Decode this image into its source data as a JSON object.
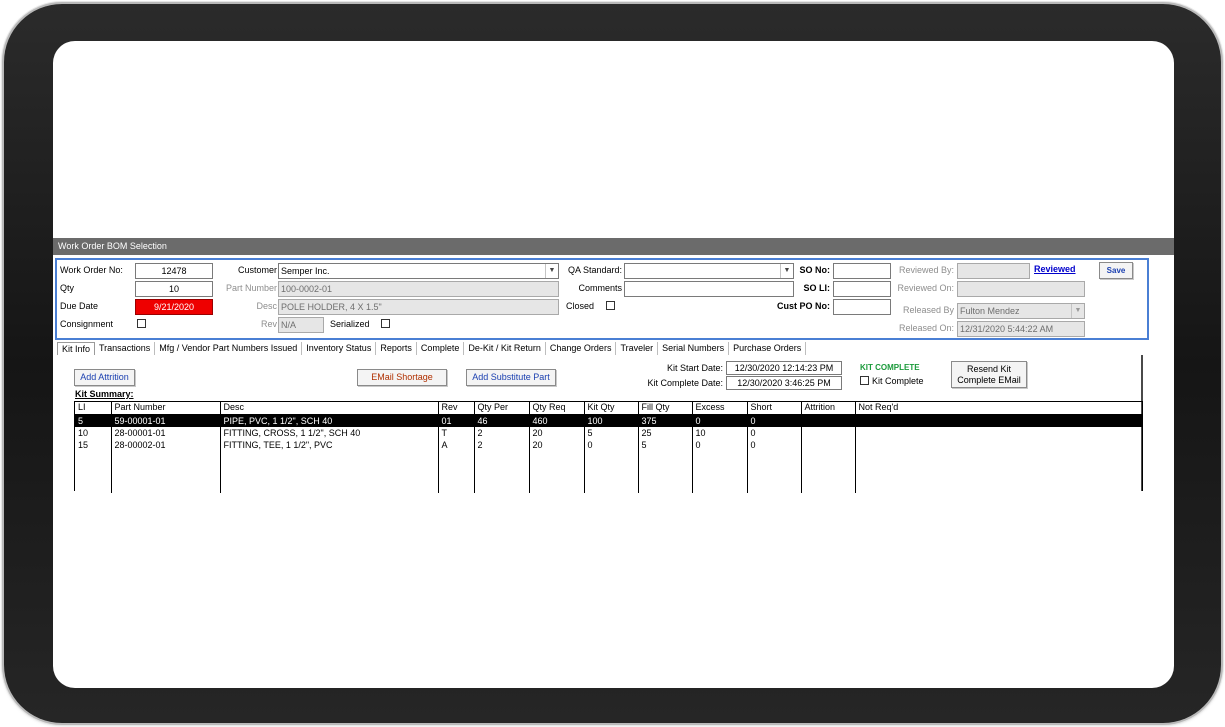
{
  "window": {
    "title": "Work Order BOM Selection"
  },
  "header": {
    "work_order_no_label": "Work Order No:",
    "work_order_no": "12478",
    "qty_label": "Qty",
    "qty": "10",
    "due_date_label": "Due Date",
    "due_date": "9/21/2020",
    "consignment_label": "Consignment",
    "customer_label": "Customer",
    "customer": "Semper Inc.",
    "part_number_label": "Part Number",
    "part_number": "100-0002-01",
    "desc_label": "Desc",
    "desc": "POLE HOLDER, 4 X 1.5\"",
    "rev_label": "Rev",
    "rev": "N/A",
    "serialized_label": "Serialized",
    "qa_standard_label": "QA Standard:",
    "qa_standard": "",
    "comments_label": "Comments",
    "comments": "",
    "closed_label": "Closed",
    "so_no_label": "SO No:",
    "so_no": "",
    "so_li_label": "SO LI:",
    "so_li": "",
    "cust_po_label": "Cust PO No:",
    "cust_po": "",
    "reviewed_by_label": "Reviewed By:",
    "reviewed_by": "",
    "reviewed_link": "Reviewed",
    "save_label": "Save",
    "reviewed_on_label": "Reviewed On:",
    "reviewed_on": "",
    "released_by_label": "Released By",
    "released_by": "Fulton Mendez",
    "released_on_label": "Released On:",
    "released_on": "12/31/2020 5:44:22 AM"
  },
  "tabs": [
    "Kit Info",
    "Transactions",
    "Mfg / Vendor Part Numbers Issued",
    "Inventory Status",
    "Reports",
    "Complete",
    "De-Kit / Kit Return",
    "Change Orders",
    "Traveler",
    "Serial Numbers",
    "Purchase Orders"
  ],
  "kit_info": {
    "add_attrition_label": "Add Attrition",
    "email_shortage_label": "EMail Shortage",
    "add_substitute_label": "Add Substitute Part",
    "kit_start_label": "Kit Start Date:",
    "kit_start_date": "12/30/2020 12:14:23 PM",
    "kit_complete_date_label": "Kit Complete Date:",
    "kit_complete_date": "12/30/2020 3:46:25 PM",
    "kit_complete_status": "KIT COMPLETE",
    "kit_complete_checkbox_label": "Kit Complete",
    "resend_label_1": "Resend Kit",
    "resend_label_2": "Complete EMail",
    "summary_title": "Kit Summary:",
    "status_color": "#1a9a3a",
    "columns": [
      "LI",
      "Part Number",
      "Desc",
      "Rev",
      "Qty Per",
      "Qty Req",
      "Kit Qty",
      "Fill Qty",
      "Excess",
      "Short",
      "Attrition",
      "Not Req'd"
    ],
    "rows": [
      [
        "5",
        "59-00001-01",
        "PIPE, PVC, 1 1/2\", SCH 40",
        "01",
        "46",
        "460",
        "100",
        "375",
        "0",
        "0",
        "",
        ""
      ],
      [
        "10",
        "28-00001-01",
        "FITTING, CROSS, 1 1/2\", SCH 40",
        "T",
        "2",
        "20",
        "5",
        "25",
        "10",
        "0",
        "",
        ""
      ],
      [
        "15",
        "28-00002-01",
        "FITTING, TEE, 1 1/2\", PVC",
        "A",
        "2",
        "20",
        "0",
        "5",
        "0",
        "0",
        "",
        ""
      ]
    ]
  }
}
